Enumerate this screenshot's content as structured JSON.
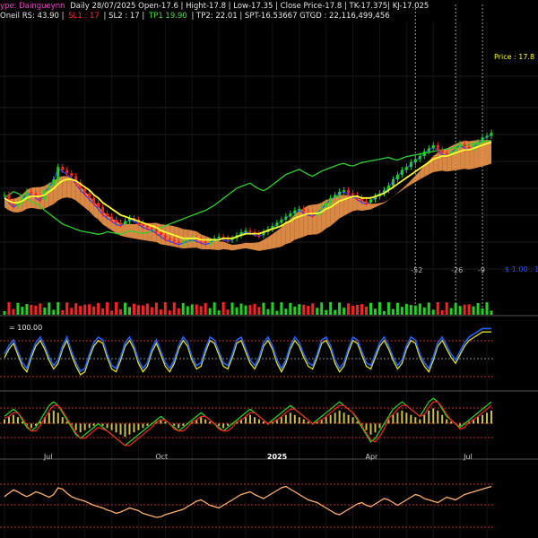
{
  "header": {
    "segments": [
      {
        "text": "ype: Daingueynn",
        "color": "#ff3cd2"
      },
      {
        "text": "Daily 28/07/2025 Open-17.6 | Hight-17.8 | Low-17.35 | Close Price-17.8 | TK-17.375| KJ-17.025",
        "color": "#e6e6e6"
      }
    ],
    "line2": [
      {
        "text": "Oneil RS: 43.90 |",
        "color": "#e6e6e6"
      },
      {
        "text": "SL1 : 17",
        "color": "#ff3030"
      },
      {
        "text": "| SL2 : 17 |",
        "color": "#e6e6e6"
      },
      {
        "text": "TP1 19.90",
        "color": "#40e040"
      },
      {
        "text": "| TP2: 22.01 | SPT-16.53667 GTGD : 22,116,499,456",
        "color": "#e6e6e6"
      }
    ]
  },
  "price_label": "Price : 17.8",
  "right_edge_label": "$ 1.00 . 1",
  "vertical_markers": [
    {
      "label": "-52",
      "bar": 92
    },
    {
      "label": "-26",
      "bar": 101
    },
    {
      "label": "-9",
      "bar": 107
    }
  ],
  "oscillator_label": "= 100.00",
  "x_axis_labels": [
    "Jul",
    "Oct",
    "2025",
    "Apr",
    "Jul"
  ],
  "x_axis_label_bars": [
    10,
    35,
    60,
    82,
    104
  ],
  "colors": {
    "up_candle": "#1fd41f",
    "down_candle": "#ff2020",
    "ma_yellow": "#ffff30",
    "ma_blue": "#2040ff",
    "lagging_green": "#30d030",
    "cloud_orange": "#ffa050",
    "cloud_gray": "#c0c0c0",
    "osc_blue": "#2060ff",
    "osc_yellow": "#e0e020",
    "macd_green": "#20e020",
    "macd_red": "#ff2020",
    "bottom_line": "#ffb070",
    "bottom_fill": "#ffd000"
  },
  "chart_data": {
    "type": "line",
    "title": "",
    "x": [
      0,
      1,
      2,
      3,
      4,
      5,
      6,
      7,
      8,
      9,
      10,
      11,
      12,
      13,
      14,
      15,
      16,
      17,
      18,
      19,
      20,
      21,
      22,
      23,
      24,
      25,
      26,
      27,
      28,
      29,
      30,
      31,
      32,
      33,
      34,
      35,
      36,
      37,
      38,
      39,
      40,
      41,
      42,
      43,
      44,
      45,
      46,
      47,
      48,
      49,
      50,
      51,
      52,
      53,
      54,
      55,
      56,
      57,
      58,
      59,
      60,
      61,
      62,
      63,
      64,
      65,
      66,
      67,
      68,
      69,
      70,
      71,
      72,
      73,
      74,
      75,
      76,
      77,
      78,
      79,
      80,
      81,
      82,
      83,
      84,
      85,
      86,
      87,
      88,
      89,
      90,
      91,
      92,
      93,
      94,
      95,
      96,
      97,
      98,
      99,
      100,
      101,
      102,
      103,
      104,
      105,
      106,
      107,
      108,
      109
    ],
    "series": [
      {
        "values": [
          42,
          38,
          35,
          37,
          40,
          44,
          43,
          41,
          39,
          45,
          48,
          52,
          60,
          58,
          56,
          54,
          50,
          46,
          43,
          40,
          37,
          34,
          30,
          28,
          26,
          24,
          23,
          25,
          27,
          26,
          24,
          22,
          21,
          20,
          18,
          16,
          14,
          13,
          12,
          11,
          12,
          13,
          14,
          13,
          12,
          11,
          12,
          14,
          15,
          14,
          13,
          14,
          16,
          18,
          19,
          18,
          17,
          16,
          18,
          20,
          22,
          24,
          26,
          28,
          30,
          32,
          33,
          31,
          30,
          29,
          31,
          34,
          37,
          40,
          42,
          44,
          45,
          43,
          42,
          40,
          38,
          37,
          39,
          41,
          43,
          45,
          48,
          52,
          55,
          58,
          60,
          63,
          65,
          67,
          70,
          72,
          74,
          71,
          69,
          68,
          70,
          73,
          75,
          73,
          72,
          74,
          76,
          79,
          80,
          82
        ]
      },
      {
        "values": [
          40,
          38,
          37,
          37,
          38,
          40,
          41,
          41,
          41,
          42,
          44,
          46,
          49,
          51,
          52,
          52,
          51,
          49,
          47,
          45,
          42,
          40,
          37,
          35,
          33,
          31,
          29,
          28,
          27,
          26,
          25,
          24,
          23,
          22,
          21,
          19,
          18,
          17,
          16,
          15,
          14,
          14,
          14,
          14,
          13,
          13,
          13,
          13,
          13,
          14,
          14,
          14,
          15,
          16,
          17,
          17,
          17,
          17,
          18,
          19,
          20,
          21,
          22,
          24,
          25,
          27,
          28,
          29,
          30,
          30,
          30,
          31,
          33,
          34,
          36,
          38,
          39,
          40,
          41,
          41,
          40,
          40,
          40,
          41,
          42,
          43,
          45,
          47,
          49,
          51,
          53,
          55,
          57,
          59,
          61,
          63,
          65,
          66,
          67,
          67,
          68,
          69,
          70,
          71,
          71,
          72,
          73,
          74,
          75,
          76
        ]
      },
      {
        "values": [
          41,
          37,
          34,
          36,
          39,
          43,
          42,
          40,
          38,
          44,
          47,
          51,
          59,
          57,
          55,
          53,
          49,
          45,
          42,
          39,
          36,
          33,
          29,
          27,
          25,
          23,
          22,
          24,
          26,
          25,
          23,
          21,
          20,
          19,
          17,
          15,
          13,
          12,
          11,
          10,
          11,
          12,
          13,
          12,
          11,
          10,
          11,
          13,
          14,
          13,
          12,
          13,
          15,
          17,
          18,
          17,
          16,
          15,
          17,
          19,
          21,
          23,
          25,
          27,
          29,
          31,
          32,
          30,
          29,
          28,
          30,
          33,
          36,
          39,
          41,
          43,
          44,
          42,
          41,
          39,
          37,
          36,
          38,
          40,
          42,
          44,
          47,
          51,
          54,
          57,
          59,
          62,
          64,
          66,
          69,
          71,
          73,
          70,
          68,
          67,
          69,
          72,
          74,
          72,
          71,
          73,
          75,
          78,
          79,
          81
        ]
      },
      {
        "values": [
          55,
          58,
          62,
          60,
          57,
          54,
          50,
          48,
          45,
          40,
          36,
          32,
          28,
          24,
          22,
          20,
          18,
          16,
          15,
          14,
          13,
          12,
          13,
          15,
          14,
          13,
          12,
          14,
          16,
          15,
          14,
          13,
          14,
          16,
          18,
          20,
          22,
          24,
          26,
          28,
          30,
          32,
          34,
          36,
          38,
          40,
          43,
          46,
          50,
          54,
          58,
          62,
          66,
          68,
          70,
          72,
          68,
          65,
          63,
          66,
          70,
          74,
          78,
          82,
          84,
          86,
          88,
          85,
          82,
          80,
          83,
          86,
          88,
          90,
          92,
          94,
          95,
          93,
          92,
          94,
          96,
          97,
          98,
          99,
          100,
          101,
          102,
          100,
          99,
          101,
          103,
          104,
          105,
          106,
          107,
          108,
          109,
          110,
          111,
          112,
          113,
          114,
          115,
          116,
          117,
          118,
          119,
          120,
          121,
          122
        ]
      }
    ],
    "ylim": [
      0,
      130
    ],
    "osc_values": [
      55,
      70,
      80,
      60,
      40,
      30,
      55,
      75,
      85,
      70,
      50,
      35,
      45,
      70,
      85,
      60,
      40,
      25,
      30,
      55,
      75,
      85,
      80,
      55,
      35,
      30,
      50,
      75,
      85,
      70,
      45,
      30,
      40,
      65,
      80,
      60,
      40,
      30,
      45,
      70,
      85,
      75,
      50,
      35,
      40,
      65,
      85,
      80,
      60,
      40,
      35,
      55,
      80,
      85,
      65,
      45,
      35,
      50,
      75,
      85,
      70,
      45,
      30,
      45,
      70,
      85,
      75,
      55,
      40,
      35,
      55,
      80,
      85,
      70,
      45,
      30,
      40,
      65,
      85,
      80,
      60,
      40,
      35,
      55,
      75,
      85,
      70,
      50,
      35,
      45,
      70,
      85,
      80,
      55,
      40,
      30,
      50,
      75,
      85,
      70,
      55,
      45,
      60,
      75,
      85,
      90,
      95,
      100,
      100,
      100
    ],
    "osc_ylim": [
      0,
      110
    ],
    "macd_values": [
      2,
      3,
      4,
      3,
      1,
      -1,
      -2,
      -1,
      1,
      3,
      5,
      6,
      5,
      3,
      1,
      -1,
      -3,
      -4,
      -3,
      -2,
      -1,
      0,
      -1,
      -2,
      -3,
      -4,
      -5,
      -6,
      -5,
      -4,
      -3,
      -2,
      -1,
      0,
      1,
      2,
      1,
      0,
      -1,
      -2,
      -1,
      0,
      1,
      2,
      3,
      2,
      1,
      0,
      -1,
      -2,
      -1,
      0,
      1,
      2,
      3,
      4,
      3,
      2,
      1,
      0,
      1,
      2,
      3,
      4,
      5,
      4,
      3,
      2,
      1,
      0,
      1,
      2,
      3,
      4,
      5,
      6,
      5,
      4,
      3,
      1,
      -1,
      -3,
      -5,
      -4,
      -2,
      0,
      2,
      4,
      5,
      6,
      5,
      4,
      3,
      2,
      4,
      6,
      7,
      6,
      4,
      2,
      1,
      0,
      -1,
      0,
      1,
      2,
      3,
      4,
      5,
      6
    ],
    "macd_ylim": [
      -8,
      8
    ],
    "bottom_values": [
      55,
      60,
      65,
      62,
      58,
      55,
      58,
      62,
      60,
      57,
      54,
      58,
      68,
      66,
      60,
      55,
      52,
      50,
      48,
      45,
      42,
      40,
      38,
      35,
      33,
      30,
      32,
      35,
      38,
      36,
      34,
      30,
      28,
      26,
      24,
      25,
      28,
      30,
      32,
      34,
      36,
      40,
      44,
      48,
      50,
      46,
      42,
      40,
      38,
      42,
      46,
      50,
      54,
      58,
      60,
      62,
      58,
      55,
      52,
      56,
      60,
      64,
      68,
      70,
      66,
      62,
      58,
      54,
      50,
      48,
      46,
      42,
      38,
      34,
      30,
      28,
      32,
      36,
      40,
      44,
      46,
      42,
      40,
      44,
      48,
      52,
      50,
      46,
      42,
      46,
      50,
      54,
      58,
      56,
      52,
      50,
      48,
      46,
      50,
      54,
      52,
      50,
      54,
      58,
      60,
      62,
      64,
      66,
      68,
      70
    ],
    "bottom_ylim": [
      0,
      100
    ]
  }
}
